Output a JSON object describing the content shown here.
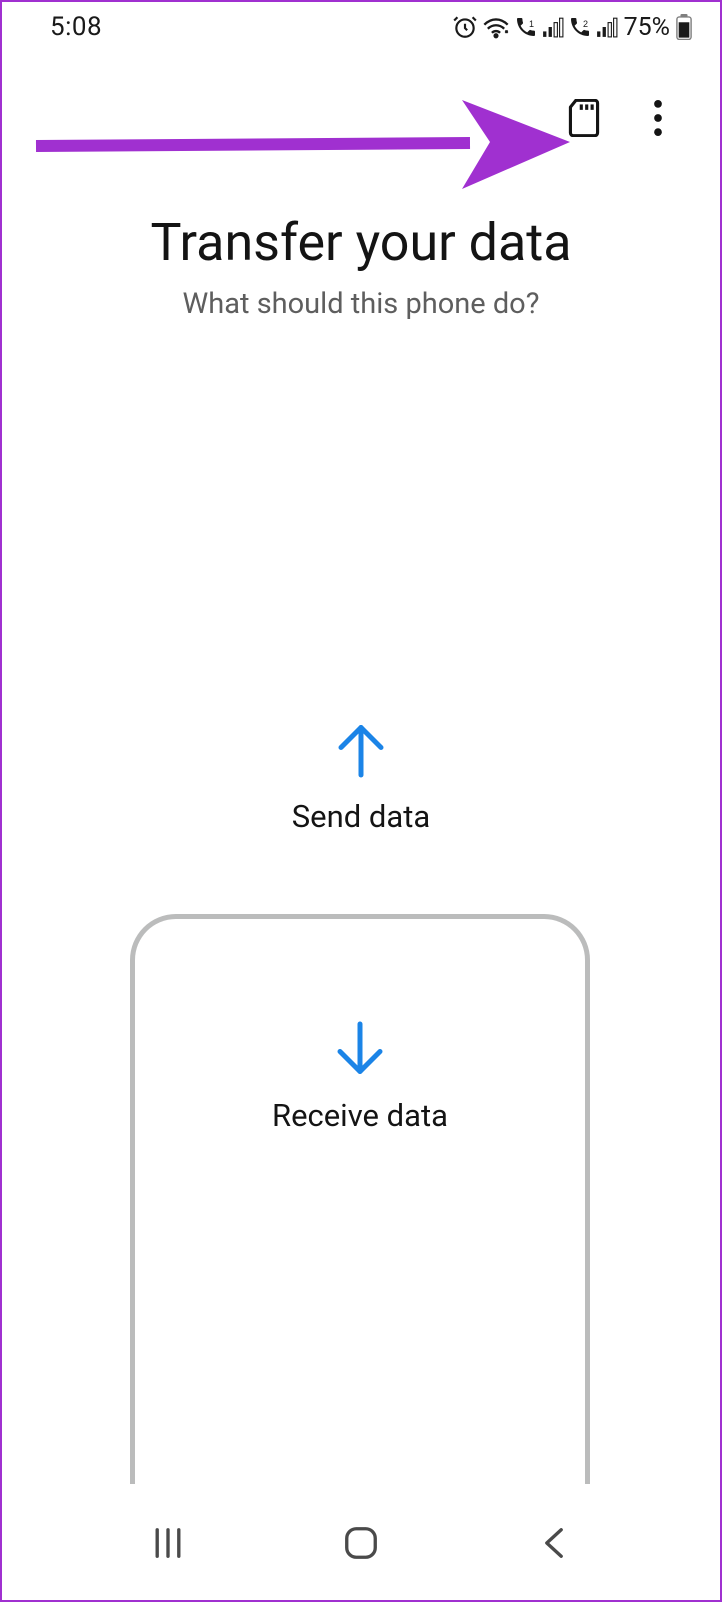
{
  "status": {
    "time": "5:08",
    "battery": "75%"
  },
  "header": {
    "title": "Transfer your data",
    "subtitle": "What should this phone do?"
  },
  "options": {
    "send": "Send data",
    "receive": "Receive data"
  },
  "colors": {
    "accent": "#1b84e7",
    "annotation": "#a030d0"
  }
}
